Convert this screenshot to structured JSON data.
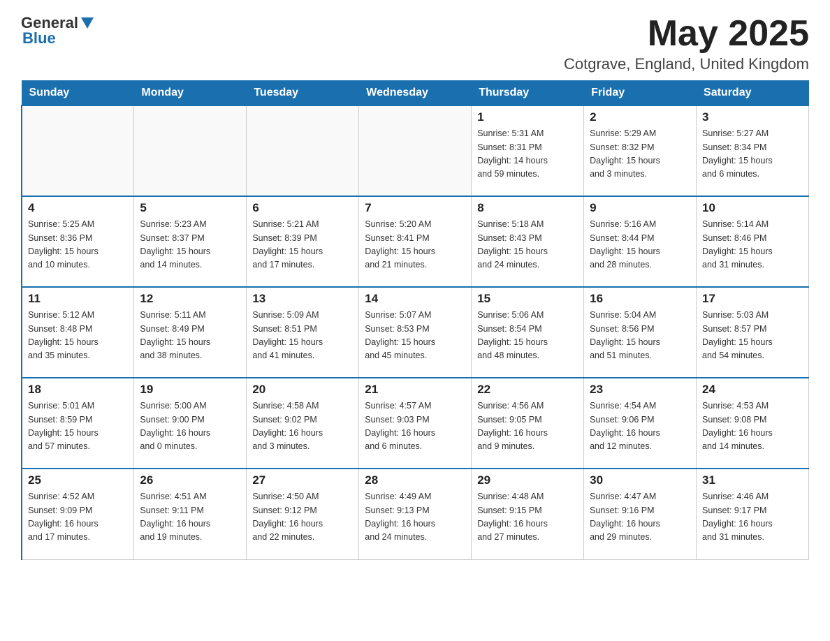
{
  "header": {
    "logo_general": "General",
    "logo_blue": "Blue",
    "month_title": "May 2025",
    "location": "Cotgrave, England, United Kingdom"
  },
  "calendar": {
    "days_of_week": [
      "Sunday",
      "Monday",
      "Tuesday",
      "Wednesday",
      "Thursday",
      "Friday",
      "Saturday"
    ],
    "weeks": [
      [
        {
          "day": "",
          "info": ""
        },
        {
          "day": "",
          "info": ""
        },
        {
          "day": "",
          "info": ""
        },
        {
          "day": "",
          "info": ""
        },
        {
          "day": "1",
          "info": "Sunrise: 5:31 AM\nSunset: 8:31 PM\nDaylight: 14 hours\nand 59 minutes."
        },
        {
          "day": "2",
          "info": "Sunrise: 5:29 AM\nSunset: 8:32 PM\nDaylight: 15 hours\nand 3 minutes."
        },
        {
          "day": "3",
          "info": "Sunrise: 5:27 AM\nSunset: 8:34 PM\nDaylight: 15 hours\nand 6 minutes."
        }
      ],
      [
        {
          "day": "4",
          "info": "Sunrise: 5:25 AM\nSunset: 8:36 PM\nDaylight: 15 hours\nand 10 minutes."
        },
        {
          "day": "5",
          "info": "Sunrise: 5:23 AM\nSunset: 8:37 PM\nDaylight: 15 hours\nand 14 minutes."
        },
        {
          "day": "6",
          "info": "Sunrise: 5:21 AM\nSunset: 8:39 PM\nDaylight: 15 hours\nand 17 minutes."
        },
        {
          "day": "7",
          "info": "Sunrise: 5:20 AM\nSunset: 8:41 PM\nDaylight: 15 hours\nand 21 minutes."
        },
        {
          "day": "8",
          "info": "Sunrise: 5:18 AM\nSunset: 8:43 PM\nDaylight: 15 hours\nand 24 minutes."
        },
        {
          "day": "9",
          "info": "Sunrise: 5:16 AM\nSunset: 8:44 PM\nDaylight: 15 hours\nand 28 minutes."
        },
        {
          "day": "10",
          "info": "Sunrise: 5:14 AM\nSunset: 8:46 PM\nDaylight: 15 hours\nand 31 minutes."
        }
      ],
      [
        {
          "day": "11",
          "info": "Sunrise: 5:12 AM\nSunset: 8:48 PM\nDaylight: 15 hours\nand 35 minutes."
        },
        {
          "day": "12",
          "info": "Sunrise: 5:11 AM\nSunset: 8:49 PM\nDaylight: 15 hours\nand 38 minutes."
        },
        {
          "day": "13",
          "info": "Sunrise: 5:09 AM\nSunset: 8:51 PM\nDaylight: 15 hours\nand 41 minutes."
        },
        {
          "day": "14",
          "info": "Sunrise: 5:07 AM\nSunset: 8:53 PM\nDaylight: 15 hours\nand 45 minutes."
        },
        {
          "day": "15",
          "info": "Sunrise: 5:06 AM\nSunset: 8:54 PM\nDaylight: 15 hours\nand 48 minutes."
        },
        {
          "day": "16",
          "info": "Sunrise: 5:04 AM\nSunset: 8:56 PM\nDaylight: 15 hours\nand 51 minutes."
        },
        {
          "day": "17",
          "info": "Sunrise: 5:03 AM\nSunset: 8:57 PM\nDaylight: 15 hours\nand 54 minutes."
        }
      ],
      [
        {
          "day": "18",
          "info": "Sunrise: 5:01 AM\nSunset: 8:59 PM\nDaylight: 15 hours\nand 57 minutes."
        },
        {
          "day": "19",
          "info": "Sunrise: 5:00 AM\nSunset: 9:00 PM\nDaylight: 16 hours\nand 0 minutes."
        },
        {
          "day": "20",
          "info": "Sunrise: 4:58 AM\nSunset: 9:02 PM\nDaylight: 16 hours\nand 3 minutes."
        },
        {
          "day": "21",
          "info": "Sunrise: 4:57 AM\nSunset: 9:03 PM\nDaylight: 16 hours\nand 6 minutes."
        },
        {
          "day": "22",
          "info": "Sunrise: 4:56 AM\nSunset: 9:05 PM\nDaylight: 16 hours\nand 9 minutes."
        },
        {
          "day": "23",
          "info": "Sunrise: 4:54 AM\nSunset: 9:06 PM\nDaylight: 16 hours\nand 12 minutes."
        },
        {
          "day": "24",
          "info": "Sunrise: 4:53 AM\nSunset: 9:08 PM\nDaylight: 16 hours\nand 14 minutes."
        }
      ],
      [
        {
          "day": "25",
          "info": "Sunrise: 4:52 AM\nSunset: 9:09 PM\nDaylight: 16 hours\nand 17 minutes."
        },
        {
          "day": "26",
          "info": "Sunrise: 4:51 AM\nSunset: 9:11 PM\nDaylight: 16 hours\nand 19 minutes."
        },
        {
          "day": "27",
          "info": "Sunrise: 4:50 AM\nSunset: 9:12 PM\nDaylight: 16 hours\nand 22 minutes."
        },
        {
          "day": "28",
          "info": "Sunrise: 4:49 AM\nSunset: 9:13 PM\nDaylight: 16 hours\nand 24 minutes."
        },
        {
          "day": "29",
          "info": "Sunrise: 4:48 AM\nSunset: 9:15 PM\nDaylight: 16 hours\nand 27 minutes."
        },
        {
          "day": "30",
          "info": "Sunrise: 4:47 AM\nSunset: 9:16 PM\nDaylight: 16 hours\nand 29 minutes."
        },
        {
          "day": "31",
          "info": "Sunrise: 4:46 AM\nSunset: 9:17 PM\nDaylight: 16 hours\nand 31 minutes."
        }
      ]
    ]
  }
}
